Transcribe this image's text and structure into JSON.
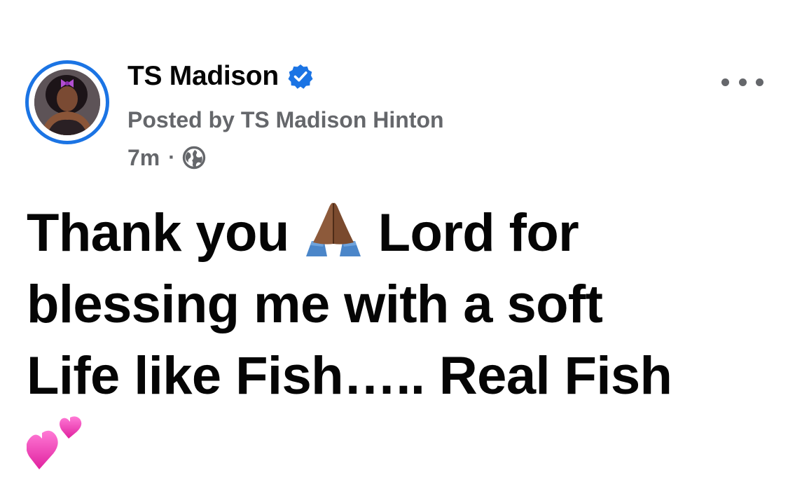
{
  "post": {
    "author_name": "TS Madison",
    "posted_by": "Posted by TS Madison Hinton",
    "timestamp": "7m",
    "separator": "·",
    "audience_icon": "globe-icon",
    "verified_icon": "verified-badge-icon",
    "more_icon": "more-options-icon",
    "body_lines": [
      "Thank you",
      "Lord for",
      "blessing me with a soft",
      "Life like Fish….. Real Fish"
    ],
    "emojis": [
      "folded-hands-emoji",
      "two-hearts-emoji"
    ]
  },
  "colors": {
    "accent": "#1b74e4",
    "text_primary": "#050505",
    "text_secondary": "#65676b",
    "background": "#ffffff"
  }
}
